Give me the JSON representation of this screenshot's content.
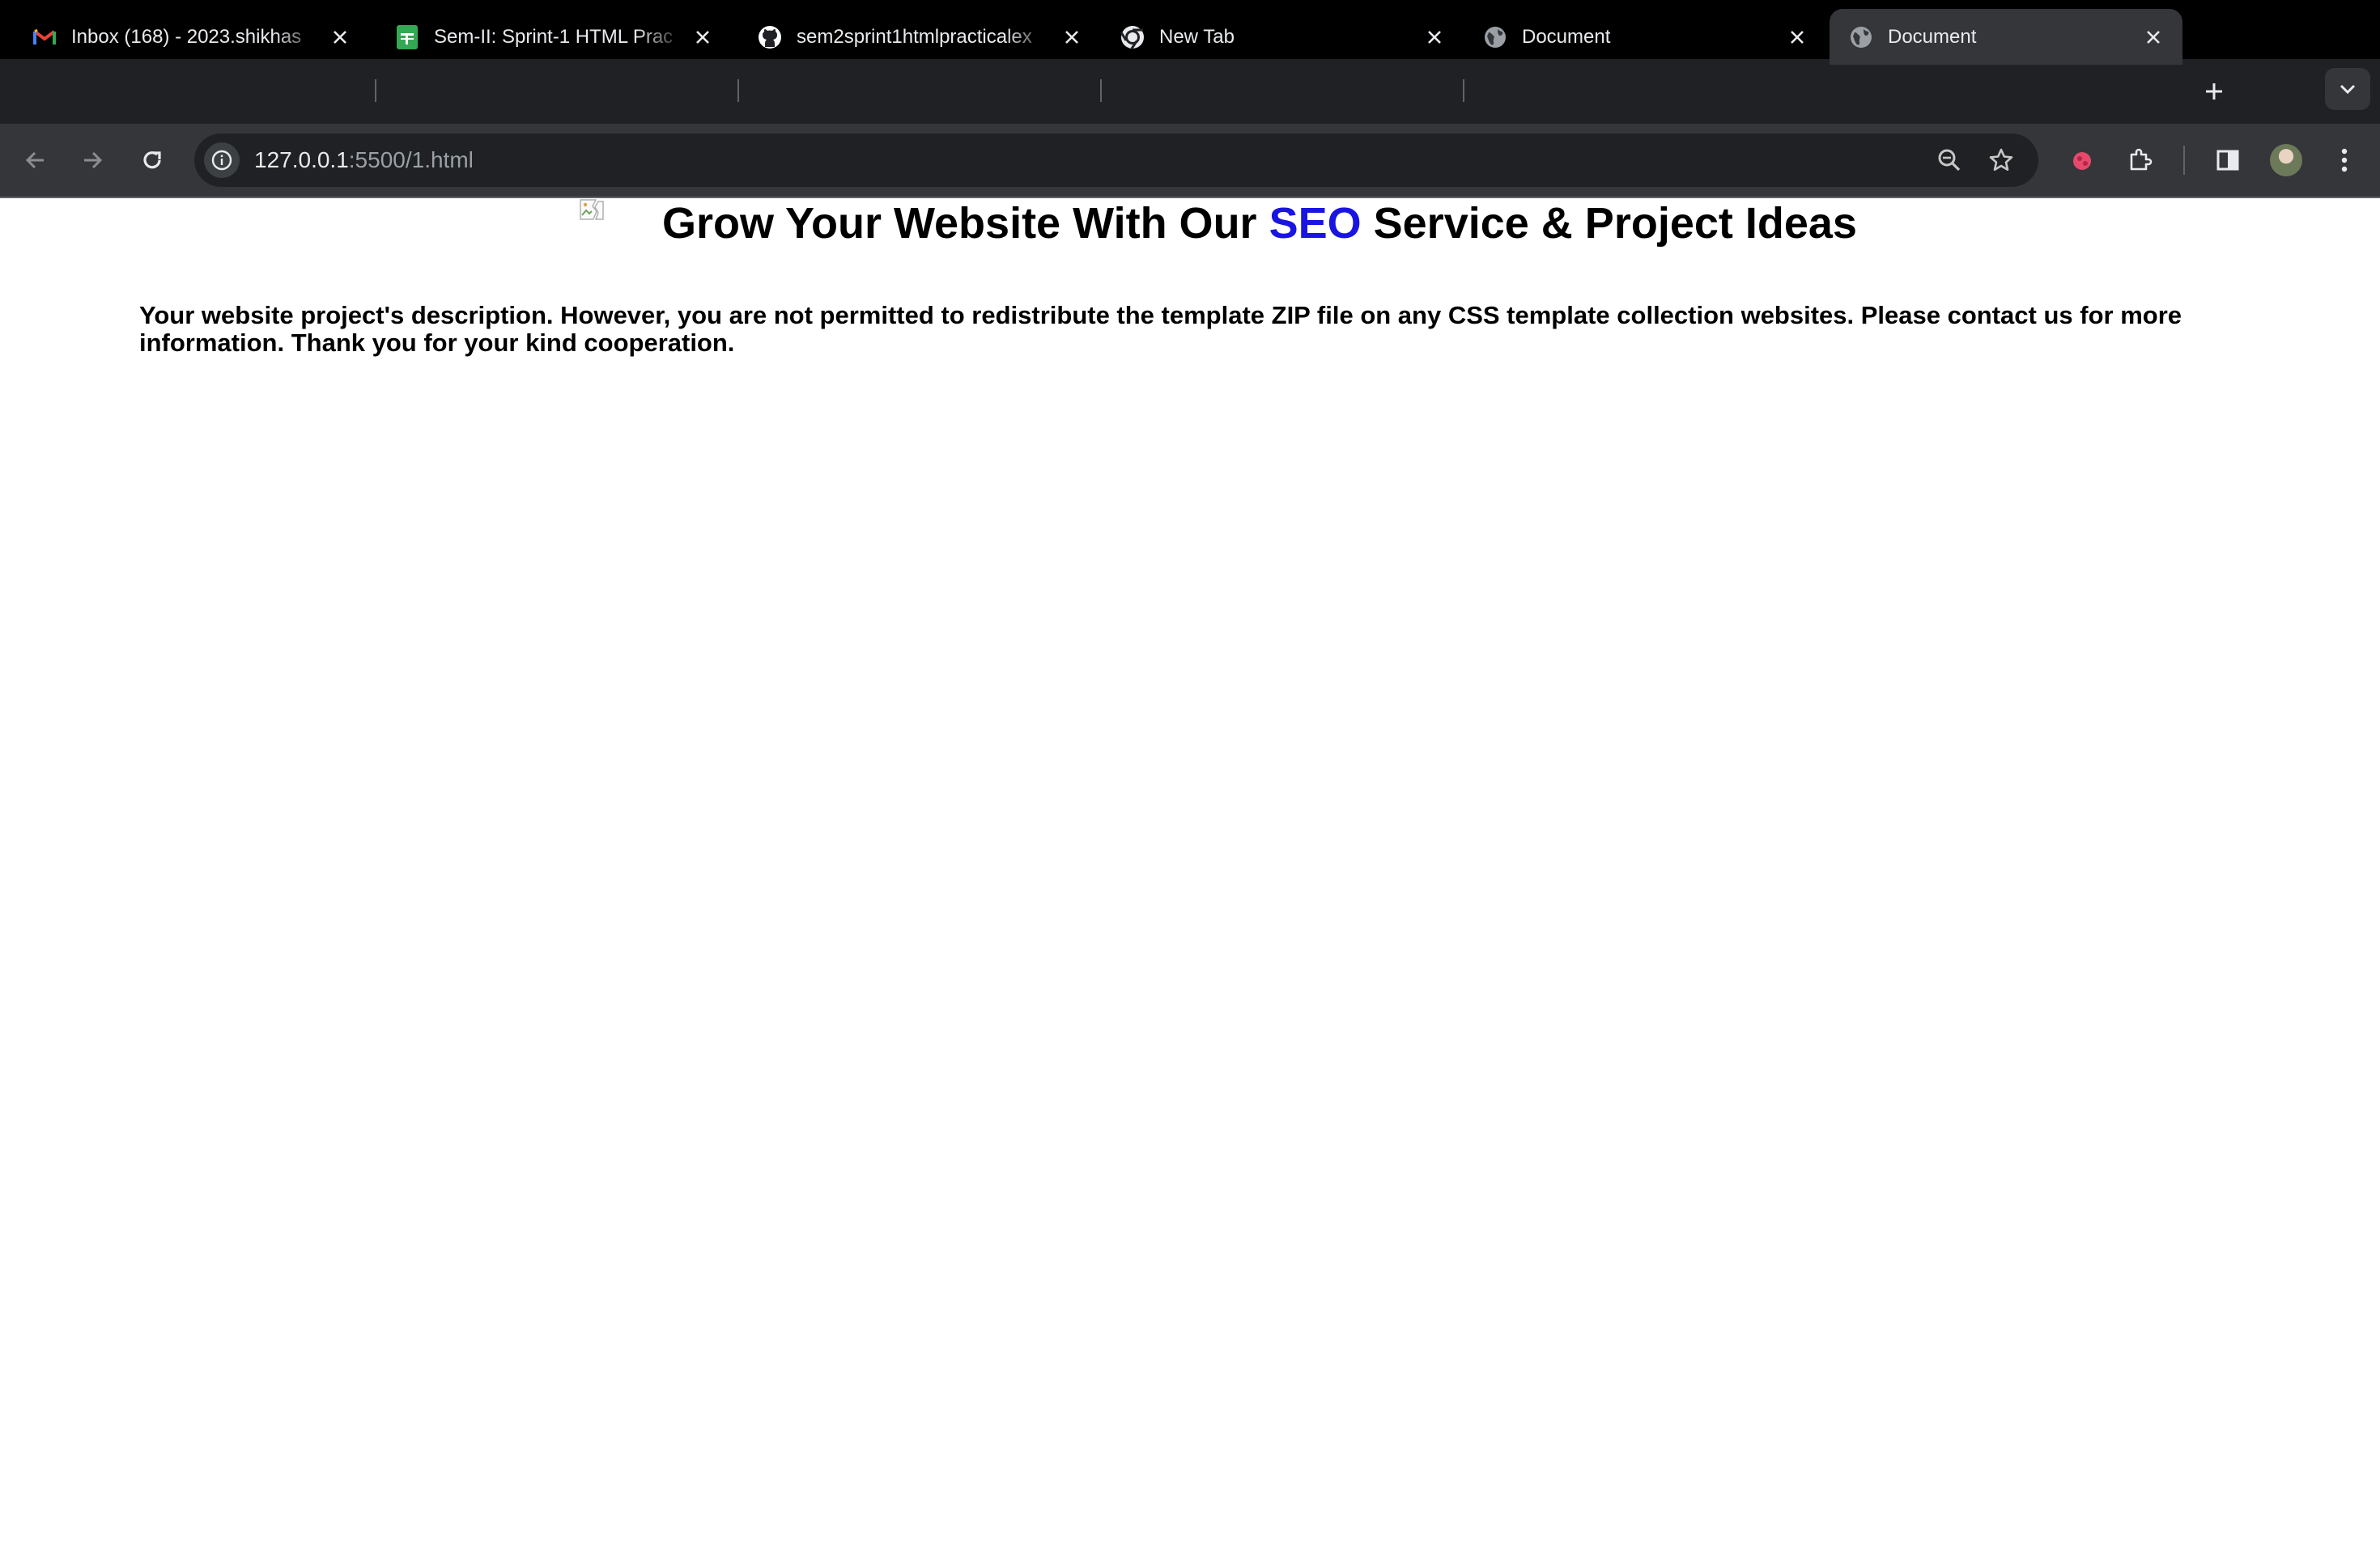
{
  "browser": {
    "tabs": [
      {
        "title": "Inbox (168) - 2023.shikhas",
        "icon": "gmail-icon"
      },
      {
        "title": "Sem-II: Sprint-1 HTML Prac",
        "icon": "sheets-icon"
      },
      {
        "title": "sem2sprint1htmlpracticalex",
        "icon": "github-icon"
      },
      {
        "title": "New Tab",
        "icon": "chrome-icon"
      },
      {
        "title": "Document",
        "icon": "globe-icon"
      },
      {
        "title": "Document",
        "icon": "globe-icon",
        "active": true
      }
    ],
    "address": {
      "host": "127.0.0.1",
      "rest": ":5500/1.html"
    }
  },
  "page": {
    "headline_before": "Grow Your Website With Our ",
    "headline_highlight": "SEO",
    "headline_after": " Service & Project Ideas",
    "description": "Your website project's description. However, you are not permitted to redistribute the template ZIP file on any CSS template collection websites. Please contact us for more information. Thank you for your kind cooperation."
  },
  "colors": {
    "highlight": "#1a14e0",
    "tabstrip": "#202124",
    "toolbar": "#35363a"
  }
}
